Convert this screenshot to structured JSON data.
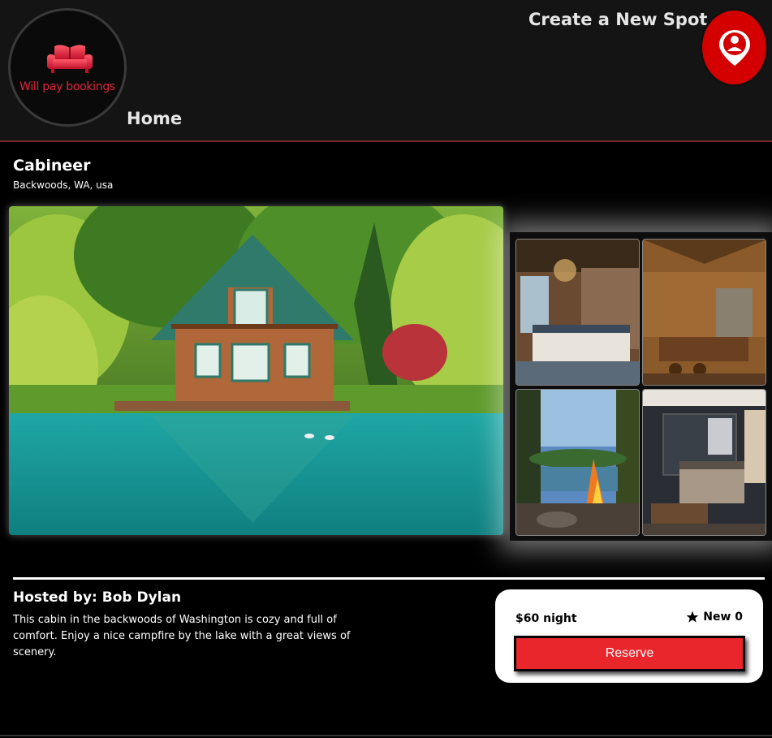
{
  "header": {
    "logo_text": "Will pay bookings",
    "home_label": "Home",
    "create_label": "Create a New Spot",
    "profile_icon": "user-location-pin-icon",
    "accent_color": "#d40000"
  },
  "spot": {
    "name": "Cabineer",
    "location": "Backwoods, WA, usa"
  },
  "images": {
    "main": "lake-cabin-photo",
    "thumbnails": [
      "log-cabin-bedroom-photo",
      "log-cabin-kitchen-photo",
      "lakeside-campfire-photo",
      "dark-bedroom-photo"
    ]
  },
  "host": {
    "heading": "Hosted by: Bob Dylan",
    "description": "This cabin in the backwoods of Washington is cozy and full of comfort. Enjoy a nice campfire by the lake with a great views of scenery."
  },
  "booking": {
    "price": "$60 night",
    "rating": "New 0",
    "rating_icon": "star-icon",
    "reserve_label": "Reserve",
    "button_color": "#e8262c"
  }
}
